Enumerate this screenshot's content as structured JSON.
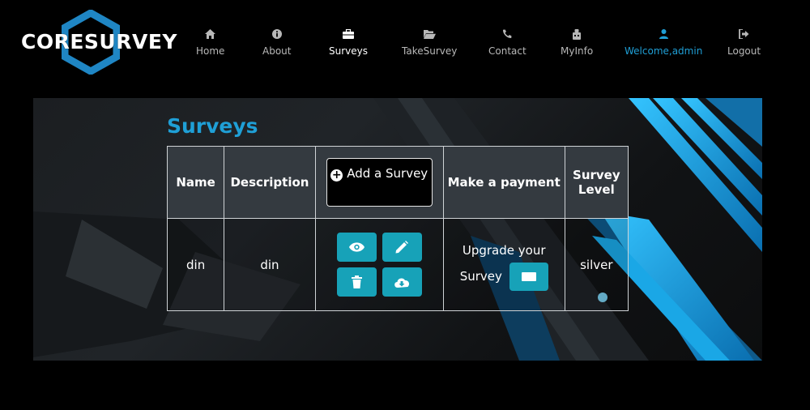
{
  "brand": {
    "name": "CORESURVEY",
    "accent_color": "#1f9fd6"
  },
  "nav": [
    {
      "label": "Home",
      "icon": "home-icon"
    },
    {
      "label": "About",
      "icon": "info-circle-icon"
    },
    {
      "label": "Surveys",
      "icon": "briefcase-icon"
    },
    {
      "label": "TakeSurvey",
      "icon": "folder-open-icon"
    },
    {
      "label": "Contact",
      "icon": "phone-icon"
    },
    {
      "label": "MyInfo",
      "icon": "user-info-icon"
    },
    {
      "label": "Welcome,admin",
      "icon": "user-icon"
    },
    {
      "label": "Logout",
      "icon": "sign-out-icon"
    }
  ],
  "page": {
    "title": "Surveys"
  },
  "table": {
    "headers": {
      "name": "Name",
      "description": "Description",
      "add_button": "Add a Survey",
      "payment": "Make a payment",
      "level": "Survey Level"
    },
    "rows": [
      {
        "name": "din",
        "description": "din",
        "payment_text": "Upgrade your Survey",
        "level": "silver"
      }
    ],
    "action_icons": [
      "eye-icon",
      "pencil-icon",
      "trash-icon",
      "cloud-download-icon"
    ],
    "button_color": "#17a2b8",
    "header_bg": "#343a40"
  }
}
